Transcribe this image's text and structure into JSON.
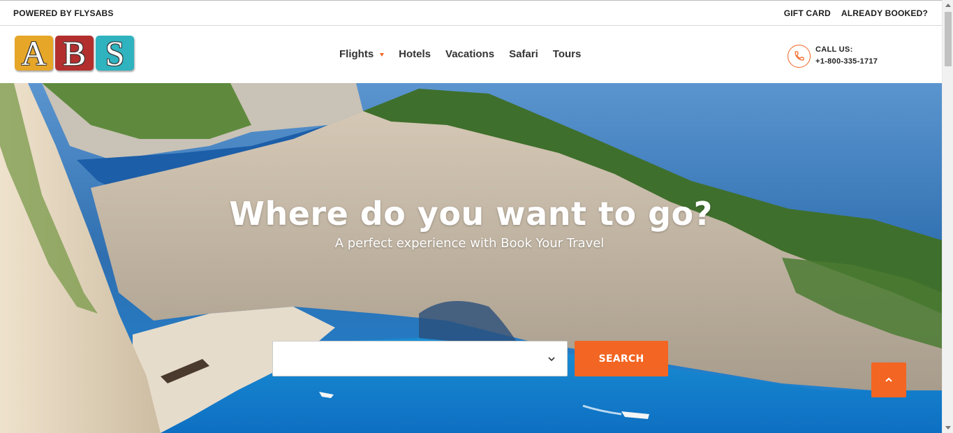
{
  "topbar": {
    "powered_by": "POWERED BY FLYSABS",
    "links": [
      "GIFT CARD",
      "ALREADY BOOKED?"
    ]
  },
  "logo": {
    "letters": [
      "A",
      "B",
      "S"
    ],
    "colors": [
      "#e6a628",
      "#b22f2e",
      "#2fb3bf"
    ]
  },
  "nav": {
    "items": [
      {
        "label": "Flights",
        "has_dropdown": true
      },
      {
        "label": "Hotels",
        "has_dropdown": false
      },
      {
        "label": "Vacations",
        "has_dropdown": false
      },
      {
        "label": "Safari",
        "has_dropdown": false
      },
      {
        "label": "Tours",
        "has_dropdown": false
      }
    ]
  },
  "contact": {
    "label": "CALL US:",
    "phone": "+1-800-335-1717",
    "icon": "phone-icon"
  },
  "hero": {
    "title": "Where do you want to go?",
    "subtitle": "A perfect experience with Book Your Travel",
    "select_value": "",
    "search_label": "SEARCH"
  },
  "colors": {
    "accent": "#f26522",
    "text": "#222222"
  }
}
